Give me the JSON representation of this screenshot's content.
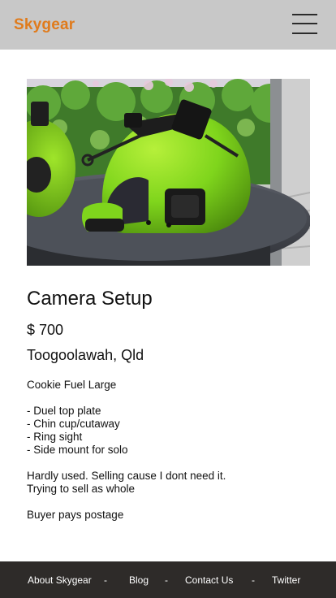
{
  "header": {
    "logo": "Skygear",
    "menu_icon": "hamburger-menu-icon"
  },
  "listing": {
    "image_icon": "helmet-photo",
    "title": "Camera Setup",
    "price": "$ 700",
    "location": "Toogoolawah, Qld",
    "intro": "Cookie Fuel Large",
    "features": [
      "- Duel top plate",
      "- Chin cup/cutaway",
      "- Ring sight",
      "- Side mount for solo"
    ],
    "note_line1": "Hardly used. Selling cause I dont need it.",
    "note_line2": "Trying to sell as whole",
    "shipping": "Buyer pays postage"
  },
  "footer": {
    "links": [
      {
        "label": "About Skygear"
      },
      {
        "label": "Blog"
      },
      {
        "label": "Contact Us"
      },
      {
        "label": "Twitter"
      }
    ],
    "separator": "-"
  },
  "colors": {
    "header_bg": "#c8c8c8",
    "brand": "#e07b1c",
    "footer_bg": "#2e2b29",
    "helmet_green": "#7fd51c"
  }
}
